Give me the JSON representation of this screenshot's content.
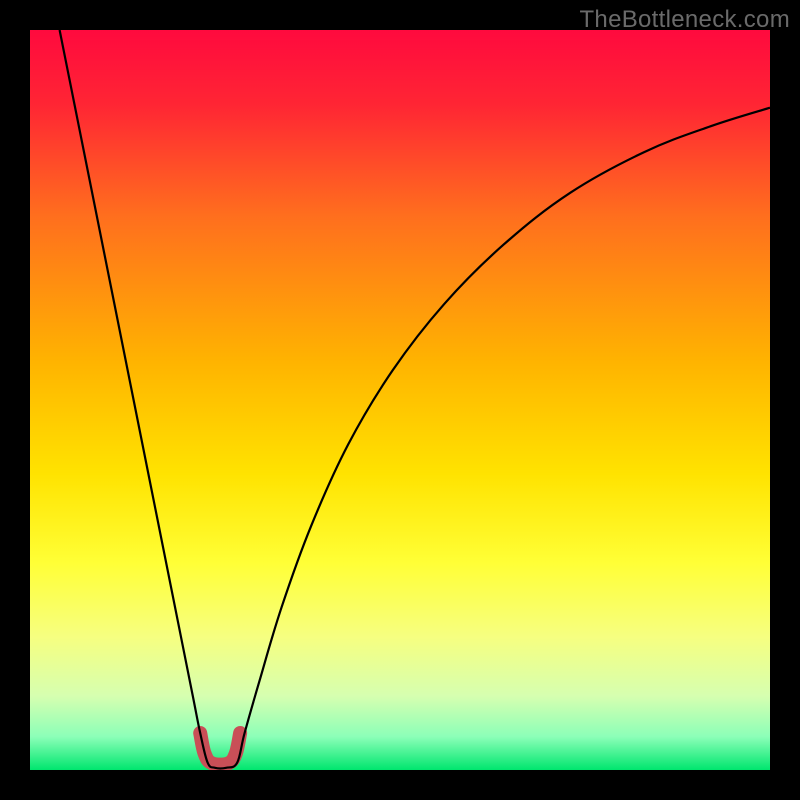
{
  "watermark": "TheBottleneck.com",
  "chart_data": {
    "type": "line",
    "title": "",
    "xlabel": "",
    "ylabel": "",
    "xlim": [
      0,
      100
    ],
    "ylim": [
      0,
      100
    ],
    "grid": false,
    "legend": false,
    "background_gradient_stops": [
      {
        "offset": 0.0,
        "color": "#ff0a3e"
      },
      {
        "offset": 0.1,
        "color": "#ff2534"
      },
      {
        "offset": 0.25,
        "color": "#ff6e1e"
      },
      {
        "offset": 0.45,
        "color": "#ffb400"
      },
      {
        "offset": 0.6,
        "color": "#ffe300"
      },
      {
        "offset": 0.72,
        "color": "#ffff36"
      },
      {
        "offset": 0.82,
        "color": "#f6ff80"
      },
      {
        "offset": 0.9,
        "color": "#d6ffb0"
      },
      {
        "offset": 0.955,
        "color": "#8cffb8"
      },
      {
        "offset": 1.0,
        "color": "#00e66e"
      }
    ],
    "series": [
      {
        "name": "bottleneck-curve",
        "stroke": "#000000",
        "stroke_width": 2.2,
        "points": [
          {
            "x": 4.0,
            "y": 100.0
          },
          {
            "x": 6.0,
            "y": 90.0
          },
          {
            "x": 8.0,
            "y": 80.0
          },
          {
            "x": 10.0,
            "y": 70.0
          },
          {
            "x": 12.0,
            "y": 60.0
          },
          {
            "x": 14.0,
            "y": 50.0
          },
          {
            "x": 16.0,
            "y": 40.0
          },
          {
            "x": 18.0,
            "y": 30.0
          },
          {
            "x": 20.0,
            "y": 20.0
          },
          {
            "x": 22.0,
            "y": 10.0
          },
          {
            "x": 23.0,
            "y": 5.0
          },
          {
            "x": 24.0,
            "y": 1.0
          },
          {
            "x": 25.0,
            "y": 0.3
          },
          {
            "x": 26.5,
            "y": 0.3
          },
          {
            "x": 28.0,
            "y": 1.0
          },
          {
            "x": 29.0,
            "y": 5.0
          },
          {
            "x": 31.0,
            "y": 12.0
          },
          {
            "x": 34.0,
            "y": 22.0
          },
          {
            "x": 38.0,
            "y": 33.0
          },
          {
            "x": 43.0,
            "y": 44.0
          },
          {
            "x": 49.0,
            "y": 54.0
          },
          {
            "x": 56.0,
            "y": 63.0
          },
          {
            "x": 64.0,
            "y": 71.0
          },
          {
            "x": 73.0,
            "y": 78.0
          },
          {
            "x": 83.0,
            "y": 83.5
          },
          {
            "x": 92.0,
            "y": 87.0
          },
          {
            "x": 100.0,
            "y": 89.5
          }
        ]
      },
      {
        "name": "optimal-zone-marker",
        "stroke": "#c94f57",
        "stroke_width": 14,
        "linecap": "round",
        "points": [
          {
            "x": 23.0,
            "y": 5.0
          },
          {
            "x": 23.6,
            "y": 2.2
          },
          {
            "x": 24.6,
            "y": 0.9
          },
          {
            "x": 26.8,
            "y": 0.9
          },
          {
            "x": 27.8,
            "y": 2.2
          },
          {
            "x": 28.4,
            "y": 5.0
          }
        ]
      }
    ]
  }
}
